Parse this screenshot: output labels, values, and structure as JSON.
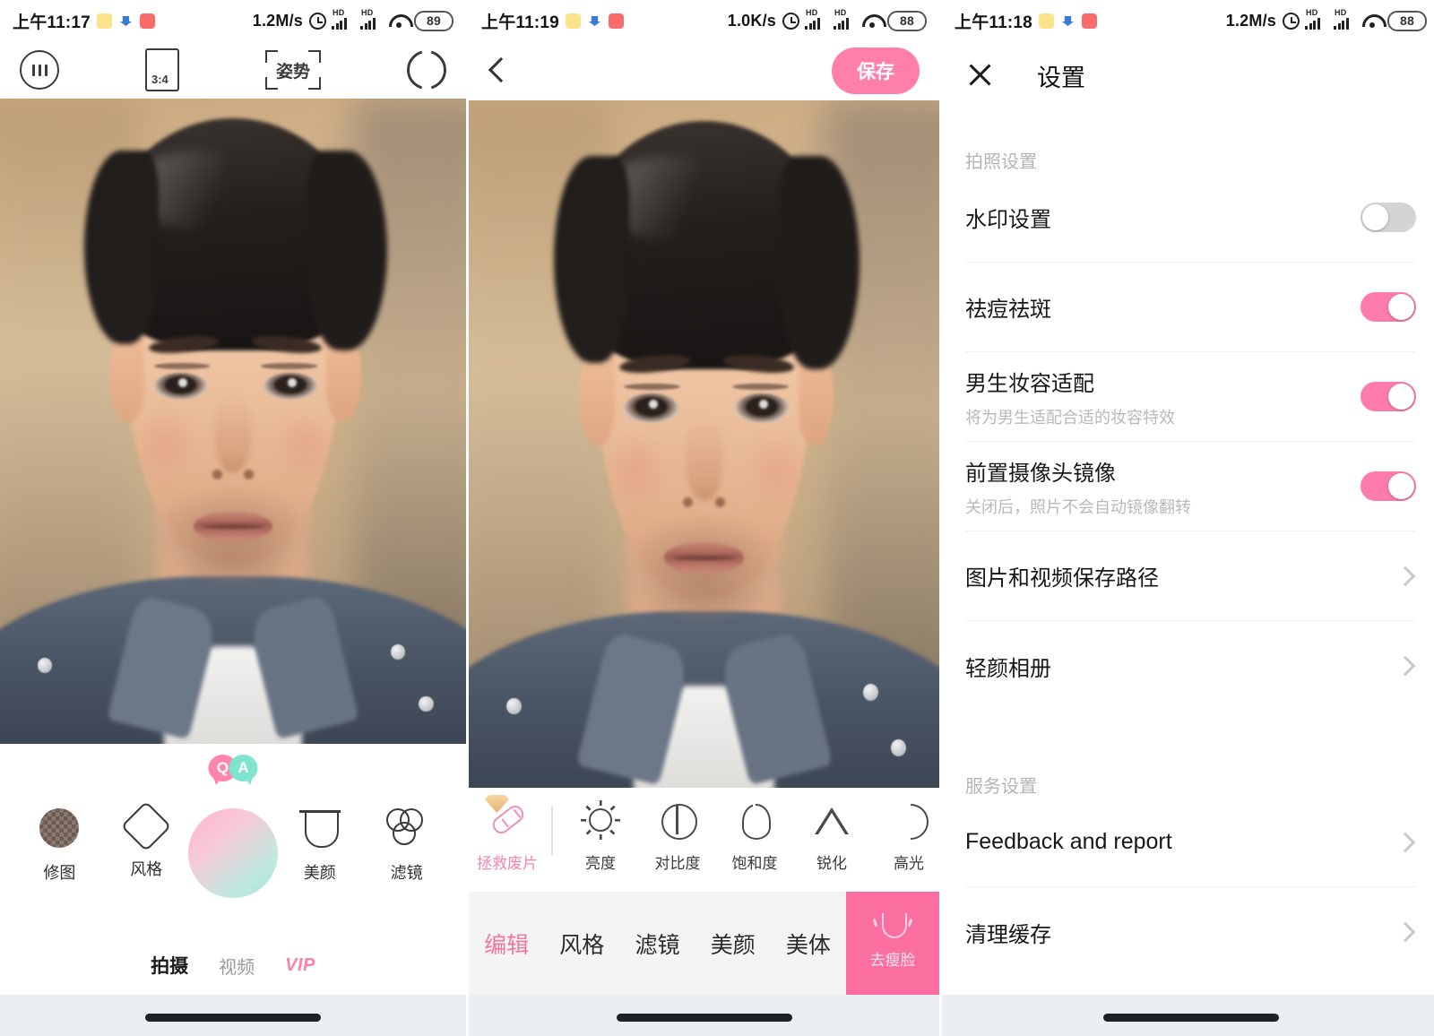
{
  "panel_camera": {
    "statusbar": {
      "time": "上午11:17",
      "network_speed": "1.2M/s",
      "battery": "89",
      "icons": [
        "note-icon",
        "cloud-icon",
        "app-icon",
        "alarm-icon",
        "signal-hd-icon",
        "signal-hd-icon-2",
        "wifi-icon",
        "battery-icon"
      ]
    },
    "toolbar": {
      "filter_label": "",
      "ratio_label": "3:4",
      "pose_label": "姿势",
      "flip_label": ""
    },
    "qa_badge": {
      "q": "Q",
      "a": "A"
    },
    "actions": [
      {
        "label": "修图",
        "icon": "photo-thumbnail-icon"
      },
      {
        "label": "风格",
        "icon": "sparkle-icon"
      },
      {
        "label": "",
        "icon": "shutter-button"
      },
      {
        "label": "美颜",
        "icon": "beauty-face-icon"
      },
      {
        "label": "滤镜",
        "icon": "filter-circles-icon"
      }
    ],
    "tabs": [
      {
        "label": "拍摄",
        "state": "active"
      },
      {
        "label": "视频",
        "state": "inactive"
      },
      {
        "label": "VIP",
        "state": "vip"
      }
    ]
  },
  "panel_editor": {
    "statusbar": {
      "time": "上午11:19",
      "network_speed": "1.0K/s",
      "battery": "88"
    },
    "header": {
      "back_icon": "chevron-left-icon",
      "save_label": "保存"
    },
    "tools": [
      {
        "label": "拯救废片",
        "icon": "bandage-icon",
        "accent": true,
        "badge": "vip-gem-icon"
      },
      {
        "label": "亮度",
        "icon": "brightness-icon"
      },
      {
        "label": "对比度",
        "icon": "contrast-icon"
      },
      {
        "label": "饱和度",
        "icon": "saturation-drop-icon"
      },
      {
        "label": "锐化",
        "icon": "sharpen-triangle-icon"
      },
      {
        "label": "高光",
        "icon": "highlight-icon"
      }
    ],
    "tabs": [
      {
        "label": "编辑",
        "state": "active"
      },
      {
        "label": "风格",
        "state": "inactive"
      },
      {
        "label": "滤镜",
        "state": "inactive"
      },
      {
        "label": "美颜",
        "state": "inactive"
      },
      {
        "label": "美体",
        "state": "inactive"
      }
    ],
    "action_button": {
      "label": "去瘦脸",
      "icon": "slim-face-icon"
    }
  },
  "panel_settings": {
    "statusbar": {
      "time": "上午11:18",
      "network_speed": "1.2M/s",
      "battery": "88"
    },
    "header": {
      "close_icon": "close-icon",
      "title": "设置"
    },
    "groups": [
      {
        "title": "拍照设置",
        "rows": [
          {
            "title": "水印设置",
            "sub": "",
            "control": "toggle",
            "value": "off"
          },
          {
            "title": "祛痘祛斑",
            "sub": "",
            "control": "toggle",
            "value": "on"
          },
          {
            "title": "男生妆容适配",
            "sub": "将为男生适配合适的妆容特效",
            "control": "toggle",
            "value": "on"
          },
          {
            "title": "前置摄像头镜像",
            "sub": "关闭后，照片不会自动镜像翻转",
            "control": "toggle",
            "value": "on"
          },
          {
            "title": "图片和视频保存路径",
            "sub": "",
            "control": "chevron"
          },
          {
            "title": "轻颜相册",
            "sub": "",
            "control": "chevron"
          }
        ]
      },
      {
        "title": "服务设置",
        "rows": [
          {
            "title": "Feedback and report",
            "sub": "",
            "control": "chevron"
          },
          {
            "title": "清理缓存",
            "sub": "",
            "control": "chevron"
          }
        ]
      }
    ]
  },
  "colors": {
    "accent_pink": "#fa6fa0",
    "save_pink": "#ff7fab",
    "toggle_on": "#fd7cab",
    "toggle_off": "#d4d4d4",
    "vip_pink": "#ff7fa8",
    "shutter_gradient_start": "#ffb3cd",
    "shutter_gradient_end": "#9fe3d6"
  }
}
